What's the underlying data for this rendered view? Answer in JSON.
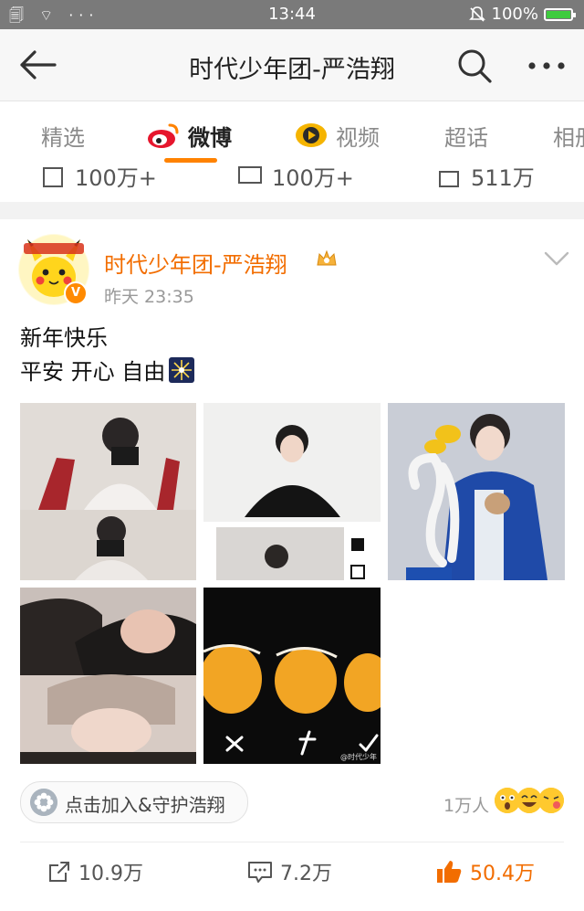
{
  "status_bar": {
    "left_icons": "🗐 ⌔ ···",
    "time": "13:44",
    "battery_text": "100%"
  },
  "nav": {
    "title": "时代少年团-严浩翔"
  },
  "tabs": [
    {
      "label": "精选"
    },
    {
      "label": "微博"
    },
    {
      "label": "视频"
    },
    {
      "label": "超话"
    },
    {
      "label": "相册"
    }
  ],
  "previous_post": {
    "repost_count": "100万+",
    "comment_count": "100万+",
    "like_count": "511万"
  },
  "post": {
    "username": "时代少年团-严浩翔",
    "time": "昨天 23:35",
    "text_line1": "新年快乐",
    "text_line2": "平安 开心 自由",
    "images": [
      {
        "name": "mirror-selfie"
      },
      {
        "name": "black-jacket-portrait"
      },
      {
        "name": "balloon-flower-portrait"
      },
      {
        "name": "hoodie-closeup"
      },
      {
        "name": "orange-fruits"
      }
    ],
    "image_watermark": "@时代少年",
    "join_label": "点击加入&守护浩翔",
    "fans_count": "1万人",
    "repost_count": "10.9万",
    "comment_count": "7.2万",
    "like_count": "50.4万"
  },
  "colors": {
    "accent": "#ff8200",
    "username": "#f26d00",
    "status_bar": "#7a7a7a"
  }
}
